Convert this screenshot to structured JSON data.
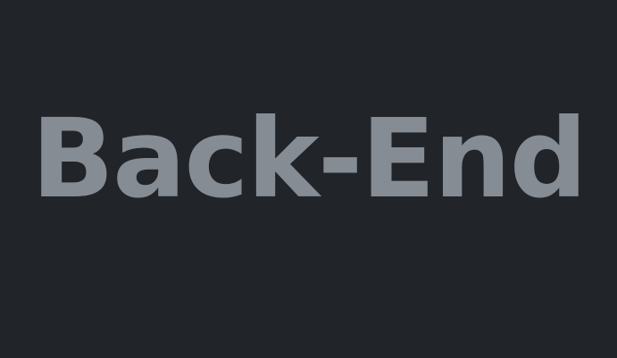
{
  "title": {
    "text": "Back-End"
  },
  "colors": {
    "background": "#212429",
    "text": "#868c94"
  }
}
